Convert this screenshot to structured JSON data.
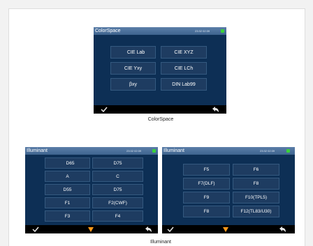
{
  "colorspace": {
    "title": "ColorSpace",
    "time": "23:32  02:39",
    "options": [
      "CIE Lab",
      "CIE XYZ",
      "CIE Yxy",
      "CIE LCh",
      "βxy",
      "DIN Lab99"
    ],
    "selected": "CIE Lab",
    "caption": "ColorSpace"
  },
  "illuminant_left": {
    "title": "Illuminant",
    "time": "23:32  02:39",
    "options": [
      "D65",
      "D75",
      "A",
      "C",
      "D55",
      "D75",
      "F1",
      "F2(CWF)",
      "F3",
      "F4"
    ],
    "selected": "D65"
  },
  "illuminant_right": {
    "title": "Illuminant",
    "time": "23:32  02:39",
    "options": [
      "F5",
      "F6",
      "F7(DLF)",
      "F8",
      "F9",
      "F10(TPL5)",
      "F8",
      "F12(TL83/U30)"
    ]
  },
  "illuminant_caption": "Illuminant",
  "icons": {
    "confirm": "check-icon",
    "page_down": "down-triangle-icon",
    "back": "return-arrow-icon",
    "battery": "battery-icon",
    "selection": "selection-arrow-icon"
  },
  "colors": {
    "screen_bg": "#0d2f55",
    "titlebar": "#4a6f99",
    "button": "#1e3c61",
    "selection_arrow": "#36d24a",
    "page_down": "#ff9a1a"
  }
}
